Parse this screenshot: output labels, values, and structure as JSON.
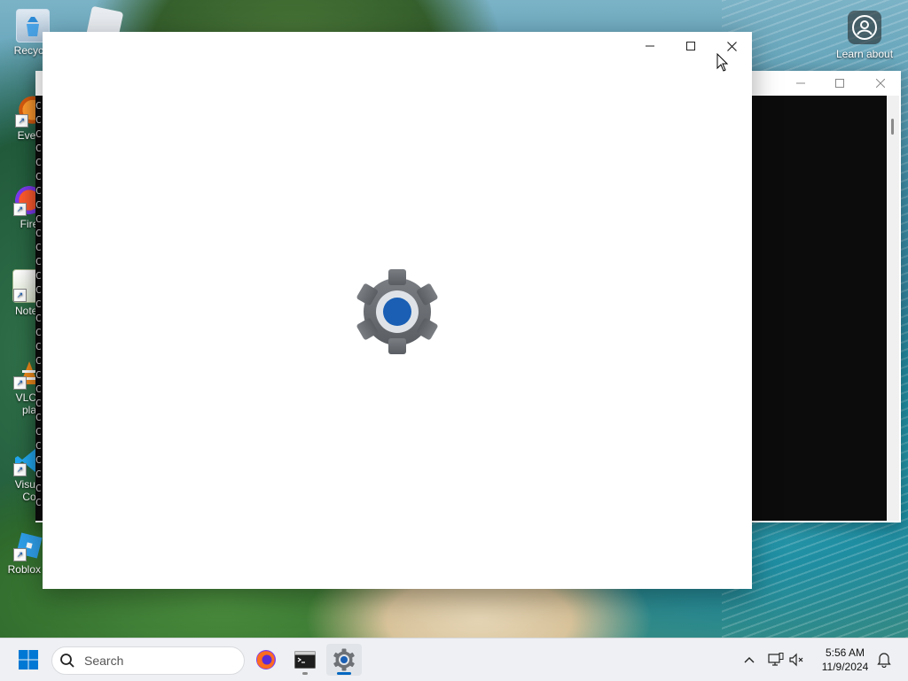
{
  "desktop": {
    "icons": [
      {
        "label": "Recycle",
        "icon": "recycle-bin-icon"
      },
      {
        "label": "Every",
        "icon": "everything-search-icon"
      },
      {
        "label": "Fire",
        "icon": "firefox-icon"
      },
      {
        "label": "Notep",
        "icon": "notepad-icon"
      },
      {
        "label_line1": "VLC r",
        "label_line2": "pla",
        "icon": "vlc-icon"
      },
      {
        "label_line1": "Visual",
        "label_line2": "Co",
        "icon": "vscode-icon"
      },
      {
        "label": "Roblox S",
        "icon": "roblox-studio-icon"
      }
    ],
    "learn_about": {
      "label": "Learn about",
      "icon": "learn-about-picture-icon"
    }
  },
  "console_window": {
    "line_char": "C",
    "colors": {
      "body": "#0c0c0c"
    }
  },
  "settings_window": {
    "icon": "settings-gear-icon",
    "colors": {
      "gear": "#6e7276",
      "center": "#1a5fb4"
    }
  },
  "taskbar": {
    "start_icon": "windows-start-icon",
    "search": {
      "placeholder": "Search"
    },
    "apps": [
      {
        "name": "Firefox",
        "icon": "firefox-icon",
        "active": false
      },
      {
        "name": "Terminal",
        "icon": "terminal-icon",
        "active": false,
        "running": true
      },
      {
        "name": "Settings",
        "icon": "settings-gear-icon",
        "active": true
      }
    ],
    "tray": {
      "chevron_icon": "chevron-up-icon",
      "network_icon": "network-icon",
      "volume_icon": "volume-muted-icon",
      "notification_icon": "notification-bell-icon"
    },
    "clock": {
      "time": "5:56 AM",
      "date": "11/9/2024"
    },
    "colors": {
      "accent": "#0067c0"
    }
  }
}
